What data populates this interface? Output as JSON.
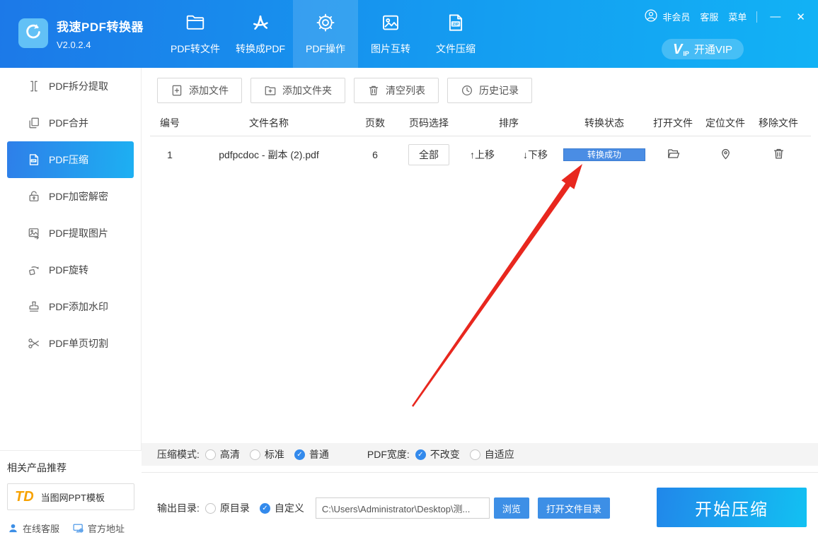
{
  "app": {
    "title": "我速PDF转换器",
    "version": "V2.0.2.4"
  },
  "header": {
    "nav": [
      {
        "label": "PDF转文件",
        "icon": "folder-icon",
        "active": false
      },
      {
        "label": "转换成PDF",
        "icon": "acrobat-icon",
        "active": false
      },
      {
        "label": "PDF操作",
        "icon": "gear-icon",
        "active": true
      },
      {
        "label": "图片互转",
        "icon": "image-icon",
        "active": false
      },
      {
        "label": "文件压缩",
        "icon": "zip-file-icon",
        "active": false
      }
    ],
    "account_label": "非会员",
    "support_label": "客服",
    "menu_label": "菜单",
    "window_controls": {
      "minimize": "—",
      "close": "✕"
    },
    "vip_button_label": "开通VIP",
    "vip_logo": {
      "v": "V",
      "ip": "IP"
    }
  },
  "sidebar": {
    "items": [
      {
        "label": "PDF拆分提取",
        "icon": "split-icon",
        "active": false
      },
      {
        "label": "PDF合并",
        "icon": "merge-icon",
        "active": false
      },
      {
        "label": "PDF压缩",
        "icon": "zip-doc-icon",
        "active": true
      },
      {
        "label": "PDF加密解密",
        "icon": "lock-icon",
        "active": false
      },
      {
        "label": "PDF提取图片",
        "icon": "image-export-icon",
        "active": false
      },
      {
        "label": "PDF旋转",
        "icon": "rotate-icon",
        "active": false
      },
      {
        "label": "PDF添加水印",
        "icon": "stamp-icon",
        "active": false
      },
      {
        "label": "PDF单页切割",
        "icon": "scissors-icon",
        "active": false
      }
    ],
    "promo": {
      "title": "相关产品推荐",
      "card": {
        "logo_text": "TD",
        "label": "当图网PPT模板"
      },
      "links": [
        {
          "label": "在线客服",
          "icon": "customer-service-icon"
        },
        {
          "label": "官方地址",
          "icon": "official-site-icon"
        }
      ]
    }
  },
  "toolbar": {
    "buttons": [
      {
        "label": "添加文件",
        "icon": "file-plus-icon"
      },
      {
        "label": "添加文件夹",
        "icon": "folder-plus-icon"
      },
      {
        "label": "清空列表",
        "icon": "trash-icon"
      },
      {
        "label": "历史记录",
        "icon": "history-icon"
      }
    ]
  },
  "table": {
    "headers": [
      "编号",
      "文件名称",
      "页数",
      "页码选择",
      "排序",
      "转换状态",
      "打开文件",
      "定位文件",
      "移除文件"
    ],
    "rows": [
      {
        "index": "1",
        "filename": "pdfpcdoc - 副本 (2).pdf",
        "pages": "6",
        "page_select_label": "全部",
        "move_up_label": "↑上移",
        "move_down_label": "↓下移",
        "status": "转换成功"
      }
    ]
  },
  "options": {
    "compress_mode": {
      "label": "压缩模式:",
      "choices": [
        {
          "label": "高清",
          "checked": false
        },
        {
          "label": "标准",
          "checked": false
        },
        {
          "label": "普通",
          "checked": true
        }
      ]
    },
    "pdf_width": {
      "label": "PDF宽度:",
      "choices": [
        {
          "label": "不改变",
          "checked": true
        },
        {
          "label": "自适应",
          "checked": false
        }
      ]
    }
  },
  "output": {
    "label": "输出目录:",
    "choices": [
      {
        "label": "原目录",
        "checked": false
      },
      {
        "label": "自定义",
        "checked": true
      }
    ],
    "path_value": "C:\\Users\\Administrator\\Desktop\\测...",
    "browse_label": "浏览",
    "open_dir_label": "打开文件目录",
    "start_label": "开始压缩"
  },
  "annotations": {
    "red_arrow": "points-to-conversion-status"
  },
  "colors": {
    "header_gradient_start": "#1c79e8",
    "header_gradient_end": "#12b2f5",
    "sidebar_active_start": "#2e7fe9",
    "sidebar_active_end": "#1db0f2",
    "status_blue": "#4a8de4",
    "accent_blue": "#3d8fe6",
    "start_gradient_start": "#2187ea",
    "start_gradient_end": "#12c1f2",
    "arrow_red": "#e8271e",
    "td_logo_orange": "#f7a200"
  }
}
